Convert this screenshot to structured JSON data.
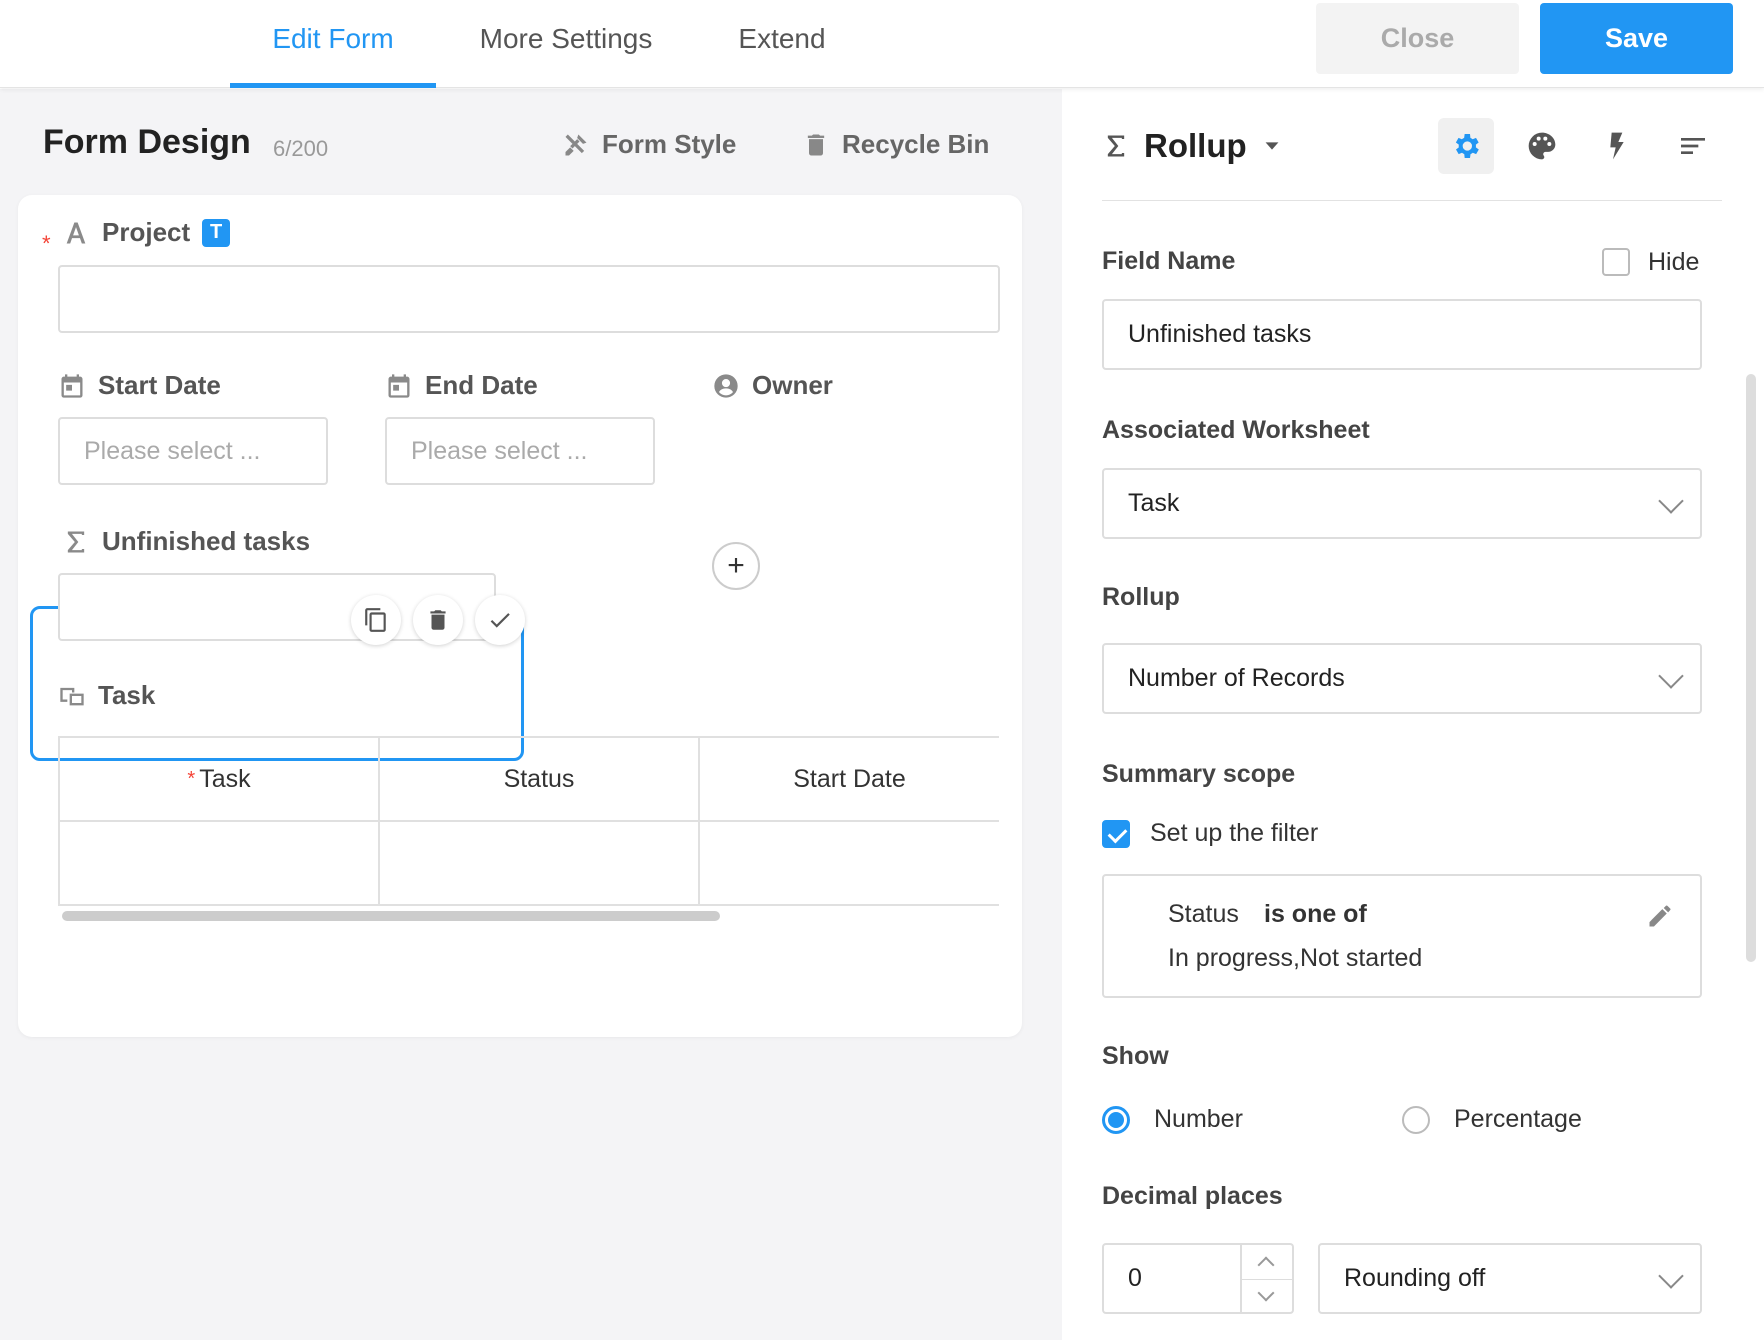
{
  "tabs": [
    {
      "label": "Edit Form",
      "active": true
    },
    {
      "label": "More Settings",
      "active": false
    },
    {
      "label": "Extend",
      "active": false
    }
  ],
  "buttons": {
    "close": "Close",
    "save": "Save"
  },
  "form": {
    "title": "Form Design",
    "count": "6/200",
    "form_style": "Form Style",
    "recycle_bin": "Recycle Bin",
    "fields": {
      "project": {
        "label": "Project",
        "badge": "T"
      },
      "start_date": {
        "label": "Start Date",
        "placeholder": "Please select ..."
      },
      "end_date": {
        "label": "End Date",
        "placeholder": "Please select ..."
      },
      "owner": {
        "label": "Owner",
        "add": "+"
      },
      "unfinished": {
        "label": "Unfinished tasks"
      },
      "task": {
        "label": "Task",
        "columns": [
          "Task",
          "Status",
          "Start Date"
        ]
      }
    },
    "required_mark": "*"
  },
  "panel": {
    "field_type": "Rollup",
    "field_name_label": "Field Name",
    "hide_label": "Hide",
    "field_name_value": "Unfinished tasks",
    "associated_label": "Associated Worksheet",
    "associated_value": "Task",
    "rollup_label": "Rollup",
    "rollup_value": "Number of Records",
    "scope_label": "Summary scope",
    "filter_check_label": "Set up the filter",
    "filter": {
      "field": "Status",
      "operator": "is one of",
      "values": "In progress,Not started"
    },
    "show_label": "Show",
    "show_options": [
      "Number",
      "Percentage"
    ],
    "decimal_label": "Decimal places",
    "decimal_value": "0",
    "rounding_value": "Rounding off"
  },
  "colors": {
    "accent": "#2196f3",
    "required": "#f44336"
  }
}
